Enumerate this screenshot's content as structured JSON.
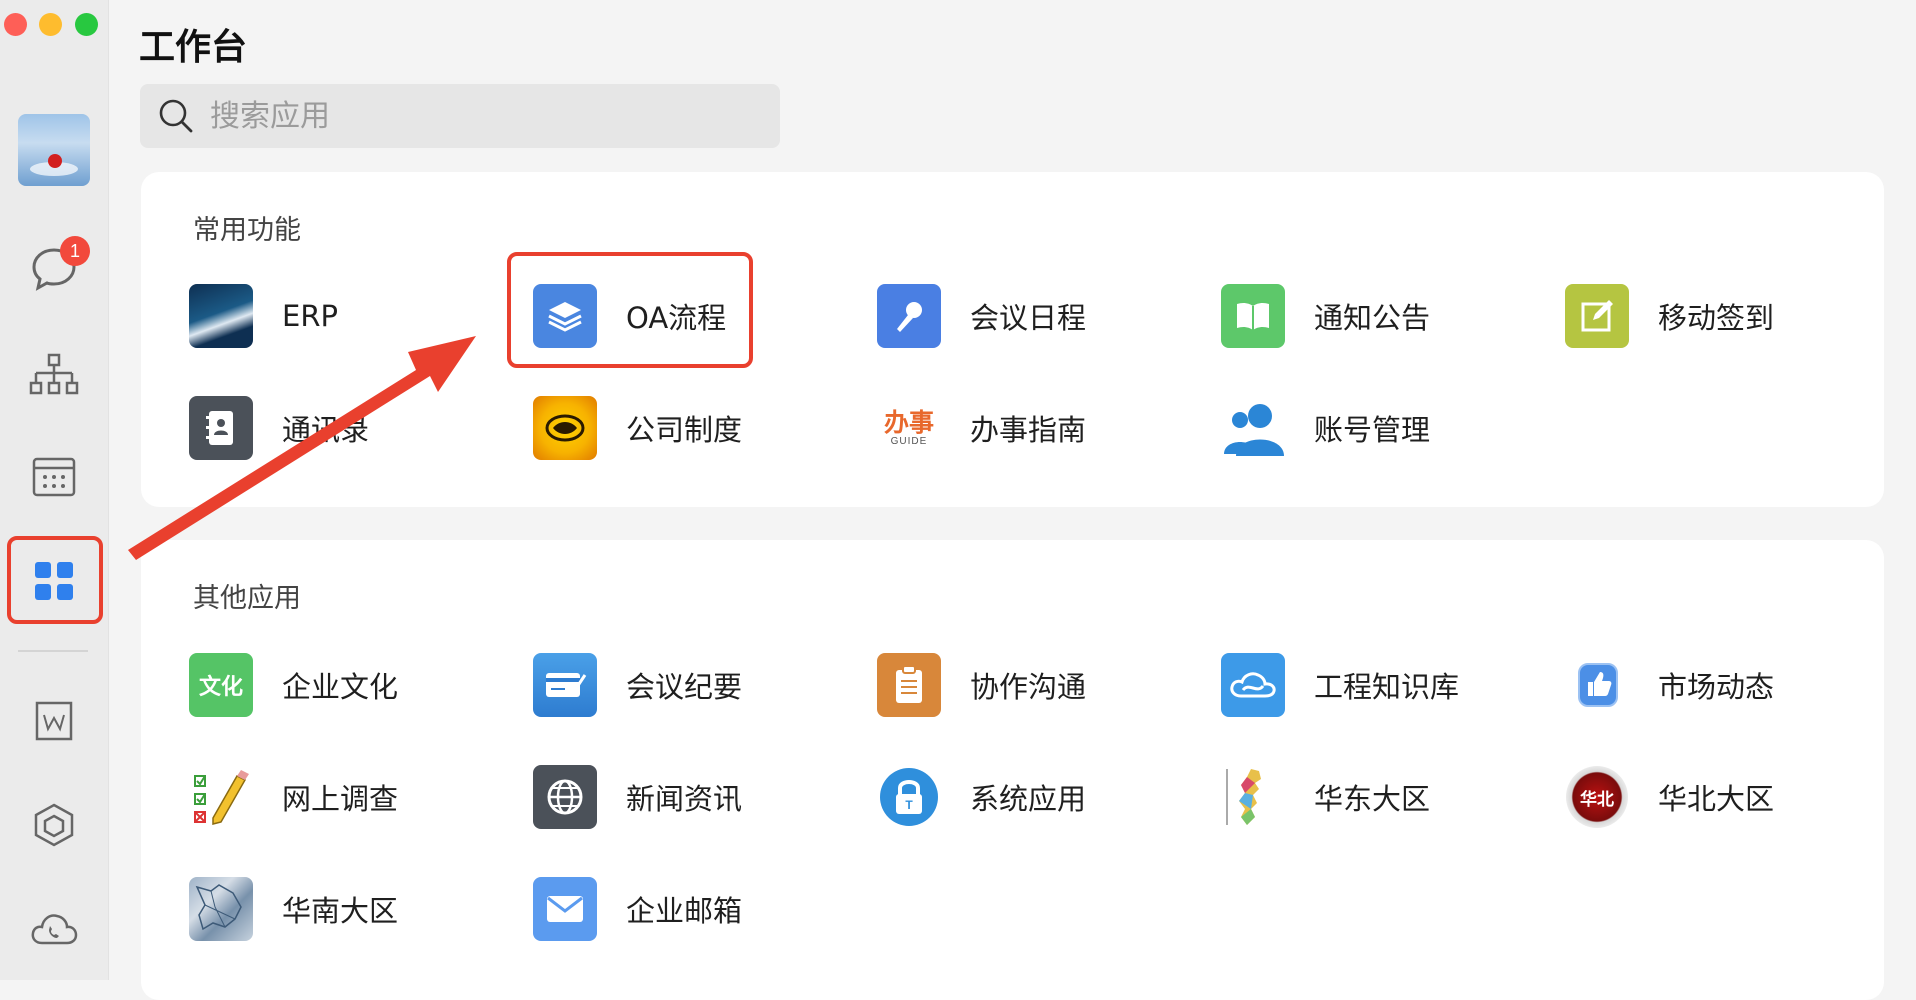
{
  "window": {
    "title": "工作台"
  },
  "rail": {
    "badge_count": "1",
    "items": [
      "avatar",
      "messages",
      "contacts",
      "calendar",
      "workbench",
      "docs",
      "app-center",
      "phone"
    ]
  },
  "search": {
    "placeholder": "搜索应用"
  },
  "sections": {
    "common": {
      "title": "常用功能",
      "apps": [
        "ERP",
        "OA流程",
        "会议日程",
        "通知公告",
        "移动签到",
        "通讯录",
        "公司制度",
        "办事指南",
        "账号管理"
      ]
    },
    "other": {
      "title": "其他应用",
      "apps": [
        "企业文化",
        "会议纪要",
        "协作沟通",
        "工程知识库",
        "市场动态",
        "网上调查",
        "新闻资讯",
        "系统应用",
        "华东大区",
        "华北大区",
        "华南大区",
        "企业邮箱"
      ]
    }
  },
  "icon_text": {
    "culture": "文化",
    "huabei": "华北",
    "banshi": "办事",
    "guide": "GUIDE"
  },
  "colors": {
    "accent_blue": "#2f80ed",
    "highlight_red": "#e9402e",
    "badge_red": "#f2493c"
  }
}
